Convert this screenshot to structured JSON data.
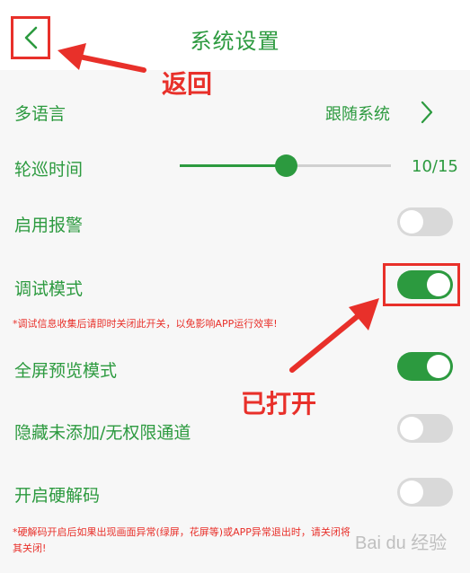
{
  "header": {
    "title": "系统设置"
  },
  "settings": {
    "language": {
      "label": "多语言",
      "value": "跟随系统"
    },
    "patrol": {
      "label": "轮巡时间",
      "value": "10/15",
      "progress": 0.5
    },
    "alarm": {
      "label": "启用报警",
      "on": false
    },
    "debug": {
      "label": "调试模式",
      "on": true,
      "note": "*调试信息收集后请即时关闭此开关，以免影响APP运行效率!"
    },
    "fullscreen": {
      "label": "全屏预览模式",
      "on": true
    },
    "hide_channels": {
      "label": "隐藏未添加/无权限通道",
      "on": false
    },
    "hw_decode": {
      "label": "开启硬解码",
      "on": false,
      "note": "*硬解码开启后如果出现画面异常(绿屏，花屏等)或APP异常退出时，请关闭将其关闭!"
    }
  },
  "annotations": {
    "back": "返回",
    "opened": "已打开"
  },
  "watermark": "Bai du 经验",
  "colors": {
    "accent": "#2c9a3f",
    "annotation": "#e8302a"
  }
}
